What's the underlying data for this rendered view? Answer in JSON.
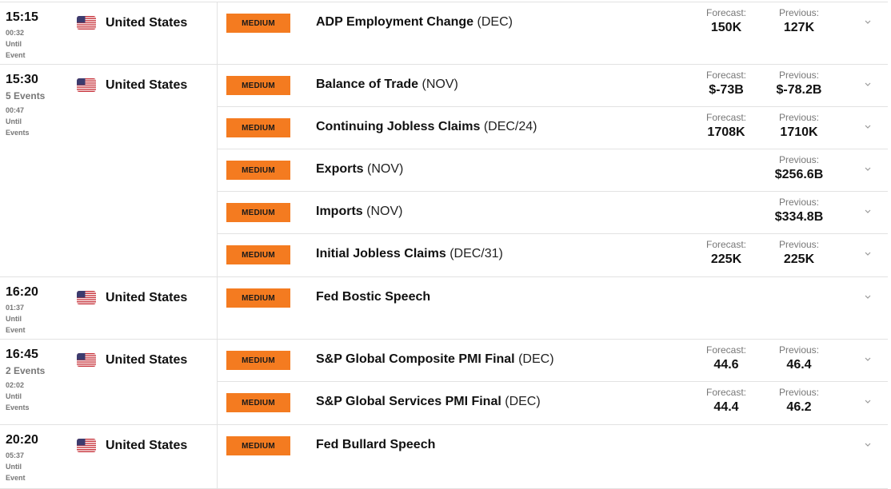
{
  "labels": {
    "forecast": "Forecast:",
    "previous": "Previous:",
    "until": "Until",
    "event_singular": "Event",
    "event_plural": "Events"
  },
  "colors": {
    "impact_medium": "#f47b20",
    "text_primary": "#111111",
    "text_muted": "#777777",
    "divider": "#e2e2e2"
  },
  "groups": [
    {
      "time": "15:15",
      "event_count": "",
      "countdown": "00:32",
      "until_line1": "Until",
      "until_line2": "Event",
      "country": "United States",
      "flag_icon": "us-flag-icon",
      "events": [
        {
          "impact": "MEDIUM",
          "name": "ADP Employment Change",
          "period": "(DEC)",
          "forecast": "150K",
          "previous": "127K"
        }
      ]
    },
    {
      "time": "15:30",
      "event_count": "5 Events",
      "countdown": "00:47",
      "until_line1": "Until",
      "until_line2": "Events",
      "country": "United States",
      "flag_icon": "us-flag-icon",
      "events": [
        {
          "impact": "MEDIUM",
          "name": "Balance of Trade",
          "period": "(NOV)",
          "forecast": "$-73B",
          "previous": "$-78.2B"
        },
        {
          "impact": "MEDIUM",
          "name": "Continuing Jobless Claims",
          "period": "(DEC/24)",
          "forecast": "1708K",
          "previous": "1710K"
        },
        {
          "impact": "MEDIUM",
          "name": "Exports",
          "period": "(NOV)",
          "forecast": null,
          "previous": "$256.6B"
        },
        {
          "impact": "MEDIUM",
          "name": "Imports",
          "period": "(NOV)",
          "forecast": null,
          "previous": "$334.8B"
        },
        {
          "impact": "MEDIUM",
          "name": "Initial Jobless Claims",
          "period": "(DEC/31)",
          "forecast": "225K",
          "previous": "225K"
        }
      ]
    },
    {
      "time": "16:20",
      "event_count": "",
      "countdown": "01:37",
      "until_line1": "Until",
      "until_line2": "Event",
      "country": "United States",
      "flag_icon": "us-flag-icon",
      "events": [
        {
          "impact": "MEDIUM",
          "name": "Fed Bostic Speech",
          "period": "",
          "forecast": null,
          "previous": null
        }
      ]
    },
    {
      "time": "16:45",
      "event_count": "2 Events",
      "countdown": "02:02",
      "until_line1": "Until",
      "until_line2": "Events",
      "country": "United States",
      "flag_icon": "us-flag-icon",
      "events": [
        {
          "impact": "MEDIUM",
          "name": "S&P Global Composite PMI Final",
          "period": "(DEC)",
          "forecast": "44.6",
          "previous": "46.4"
        },
        {
          "impact": "MEDIUM",
          "name": "S&P Global Services PMI Final",
          "period": "(DEC)",
          "forecast": "44.4",
          "previous": "46.2"
        }
      ]
    },
    {
      "time": "20:20",
      "event_count": "",
      "countdown": "05:37",
      "until_line1": "Until",
      "until_line2": "Event",
      "country": "United States",
      "flag_icon": "us-flag-icon",
      "events": [
        {
          "impact": "MEDIUM",
          "name": "Fed Bullard Speech",
          "period": "",
          "forecast": null,
          "previous": null
        }
      ]
    }
  ]
}
